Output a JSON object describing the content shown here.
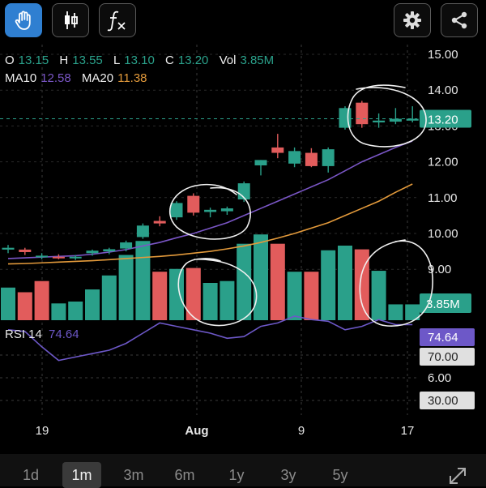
{
  "toolbar": {
    "left_buttons": [
      {
        "icon": "hand-icon",
        "active": true
      },
      {
        "icon": "candlestick-icon",
        "active": false
      },
      {
        "icon": "function-icon",
        "active": false
      }
    ],
    "right_buttons": [
      {
        "icon": "gear-icon"
      },
      {
        "icon": "share-icon"
      }
    ]
  },
  "quote": {
    "o_label": "O",
    "o_value": "13.15",
    "h_label": "H",
    "h_value": "13.55",
    "l_label": "L",
    "l_value": "13.10",
    "c_label": "C",
    "c_value": "13.20",
    "vol_label": "Vol",
    "vol_value": "3.85M",
    "ma10_label": "MA10",
    "ma10_value": "12.58",
    "ma20_label": "MA20",
    "ma20_value": "11.38"
  },
  "colors": {
    "up": "#2aa08a",
    "down": "#e25c5c",
    "ma10": "#7a56c6",
    "ma20": "#e39a3b",
    "rsi": "#6d58c8",
    "text_teal": "#2aa08a",
    "active_button": "#2f7fd1"
  },
  "chart_data": {
    "type": "candlestick",
    "y_axis_ticks": [
      "15.00",
      "14.00",
      "13.00",
      "12.00",
      "11.00",
      "10.00",
      "9.00"
    ],
    "ylim": [
      8.5,
      15.5
    ],
    "x_tick_labels": [
      "19",
      "Aug",
      "9",
      "17"
    ],
    "last_price_label": "13.20",
    "volume_label": "3.85M",
    "candles": [
      {
        "o": 9.55,
        "h": 9.68,
        "l": 9.45,
        "c": 9.6
      },
      {
        "o": 9.55,
        "h": 9.6,
        "l": 9.4,
        "c": 9.48
      },
      {
        "o": 9.35,
        "h": 9.45,
        "l": 9.28,
        "c": 9.38
      },
      {
        "o": 9.35,
        "h": 9.42,
        "l": 9.28,
        "c": 9.33
      },
      {
        "o": 9.32,
        "h": 9.4,
        "l": 9.26,
        "c": 9.35
      },
      {
        "o": 9.45,
        "h": 9.55,
        "l": 9.38,
        "c": 9.52
      },
      {
        "o": 9.5,
        "h": 9.6,
        "l": 9.42,
        "c": 9.56
      },
      {
        "o": 9.58,
        "h": 9.8,
        "l": 9.5,
        "c": 9.75
      },
      {
        "o": 9.9,
        "h": 10.28,
        "l": 9.85,
        "c": 10.22
      },
      {
        "o": 10.35,
        "h": 10.48,
        "l": 10.2,
        "c": 10.28
      },
      {
        "o": 10.45,
        "h": 10.9,
        "l": 10.38,
        "c": 10.85
      },
      {
        "o": 11.05,
        "h": 11.12,
        "l": 10.5,
        "c": 10.58
      },
      {
        "o": 10.6,
        "h": 10.72,
        "l": 10.45,
        "c": 10.66
      },
      {
        "o": 10.62,
        "h": 10.75,
        "l": 10.52,
        "c": 10.7
      },
      {
        "o": 10.95,
        "h": 11.45,
        "l": 10.88,
        "c": 11.4
      },
      {
        "o": 11.9,
        "h": 12.05,
        "l": 11.62,
        "c": 12.05
      },
      {
        "o": 12.4,
        "h": 12.78,
        "l": 12.1,
        "c": 12.25
      },
      {
        "o": 11.95,
        "h": 12.4,
        "l": 11.85,
        "c": 12.3
      },
      {
        "o": 12.25,
        "h": 12.38,
        "l": 11.85,
        "c": 11.88
      },
      {
        "o": 11.88,
        "h": 12.4,
        "l": 11.7,
        "c": 12.35
      },
      {
        "o": 12.95,
        "h": 13.55,
        "l": 12.9,
        "c": 13.5
      },
      {
        "o": 13.65,
        "h": 13.7,
        "l": 12.95,
        "c": 13.05
      },
      {
        "o": 13.1,
        "h": 13.35,
        "l": 12.95,
        "c": 13.15
      },
      {
        "o": 13.12,
        "h": 13.5,
        "l": 13.05,
        "c": 13.2
      },
      {
        "o": 13.15,
        "h": 13.55,
        "l": 13.1,
        "c": 13.2
      }
    ],
    "volume": [
      {
        "v": 0.35,
        "up": true
      },
      {
        "v": 0.3,
        "up": false
      },
      {
        "v": 0.42,
        "up": false
      },
      {
        "v": 0.18,
        "up": true
      },
      {
        "v": 0.2,
        "up": true
      },
      {
        "v": 0.33,
        "up": true
      },
      {
        "v": 0.48,
        "up": true
      },
      {
        "v": 0.7,
        "up": true
      },
      {
        "v": 0.85,
        "up": true
      },
      {
        "v": 0.52,
        "up": false
      },
      {
        "v": 0.55,
        "up": true
      },
      {
        "v": 0.56,
        "up": false
      },
      {
        "v": 0.4,
        "up": true
      },
      {
        "v": 0.42,
        "up": true
      },
      {
        "v": 0.82,
        "up": true
      },
      {
        "v": 0.92,
        "up": true
      },
      {
        "v": 0.82,
        "up": false
      },
      {
        "v": 0.52,
        "up": true
      },
      {
        "v": 0.52,
        "up": false
      },
      {
        "v": 0.75,
        "up": true
      },
      {
        "v": 0.8,
        "up": true
      },
      {
        "v": 0.76,
        "up": false
      },
      {
        "v": 0.53,
        "up": true
      },
      {
        "v": 0.17,
        "up": true
      },
      {
        "v": 0.17,
        "up": true
      }
    ],
    "ma10": [
      9.3,
      9.32,
      9.34,
      9.36,
      9.38,
      9.42,
      9.48,
      9.55,
      9.65,
      9.75,
      9.88,
      10.0,
      10.15,
      10.3,
      10.5,
      10.7,
      10.9,
      11.1,
      11.3,
      11.5,
      11.75,
      12.0,
      12.2,
      12.4,
      12.58
    ],
    "ma20": [
      9.15,
      9.16,
      9.18,
      9.2,
      9.22,
      9.24,
      9.27,
      9.3,
      9.33,
      9.36,
      9.4,
      9.45,
      9.5,
      9.57,
      9.65,
      9.75,
      9.87,
      10.0,
      10.15,
      10.3,
      10.5,
      10.7,
      10.9,
      11.15,
      11.38
    ]
  },
  "rsi": {
    "label": "RSI 14",
    "value": "74.64",
    "ticks": [
      "70.00",
      "6.00",
      "30.00"
    ],
    "series": [
      72,
      71,
      62,
      54,
      56,
      58,
      60,
      64,
      70,
      76,
      74,
      72,
      70,
      67,
      68,
      74,
      76,
      80,
      78,
      77,
      72,
      74,
      78,
      75,
      75
    ]
  },
  "periods": {
    "items": [
      "1d",
      "1m",
      "3m",
      "6m",
      "1y",
      "3y",
      "5y"
    ],
    "active": "1m"
  }
}
